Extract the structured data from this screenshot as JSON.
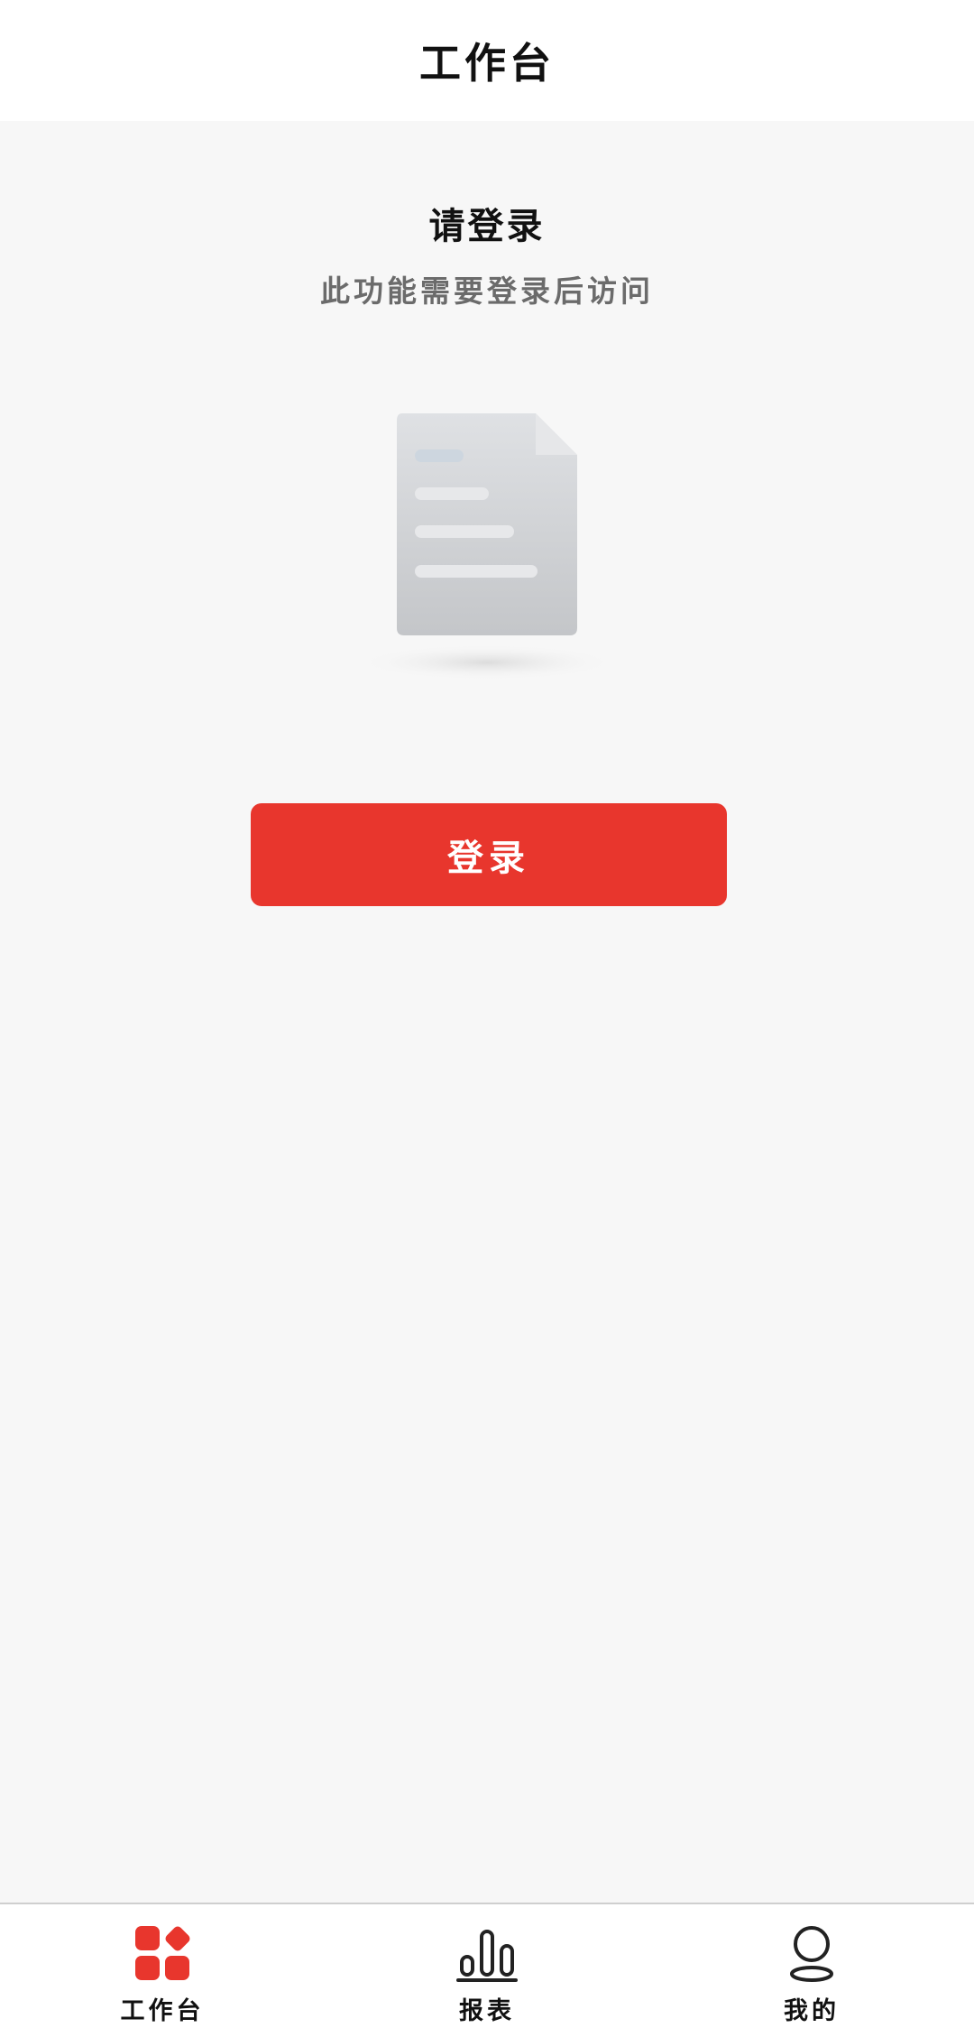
{
  "header": {
    "title": "工作台"
  },
  "login_prompt": {
    "title": "请登录",
    "subtitle": "此功能需要登录后访问",
    "button_label": "登录",
    "illustration_icon": "document-icon"
  },
  "tabbar": {
    "items": [
      {
        "label": "工作台",
        "icon": "workbench-icon",
        "active": true
      },
      {
        "label": "报表",
        "icon": "bar-chart-icon",
        "active": false
      },
      {
        "label": "我的",
        "icon": "user-icon",
        "active": false
      }
    ]
  },
  "colors": {
    "accent": "#e8362d",
    "background": "#f7f7f7",
    "header_bg": "#ffffff",
    "text_primary": "#111111",
    "text_secondary": "#6b6b6b"
  }
}
